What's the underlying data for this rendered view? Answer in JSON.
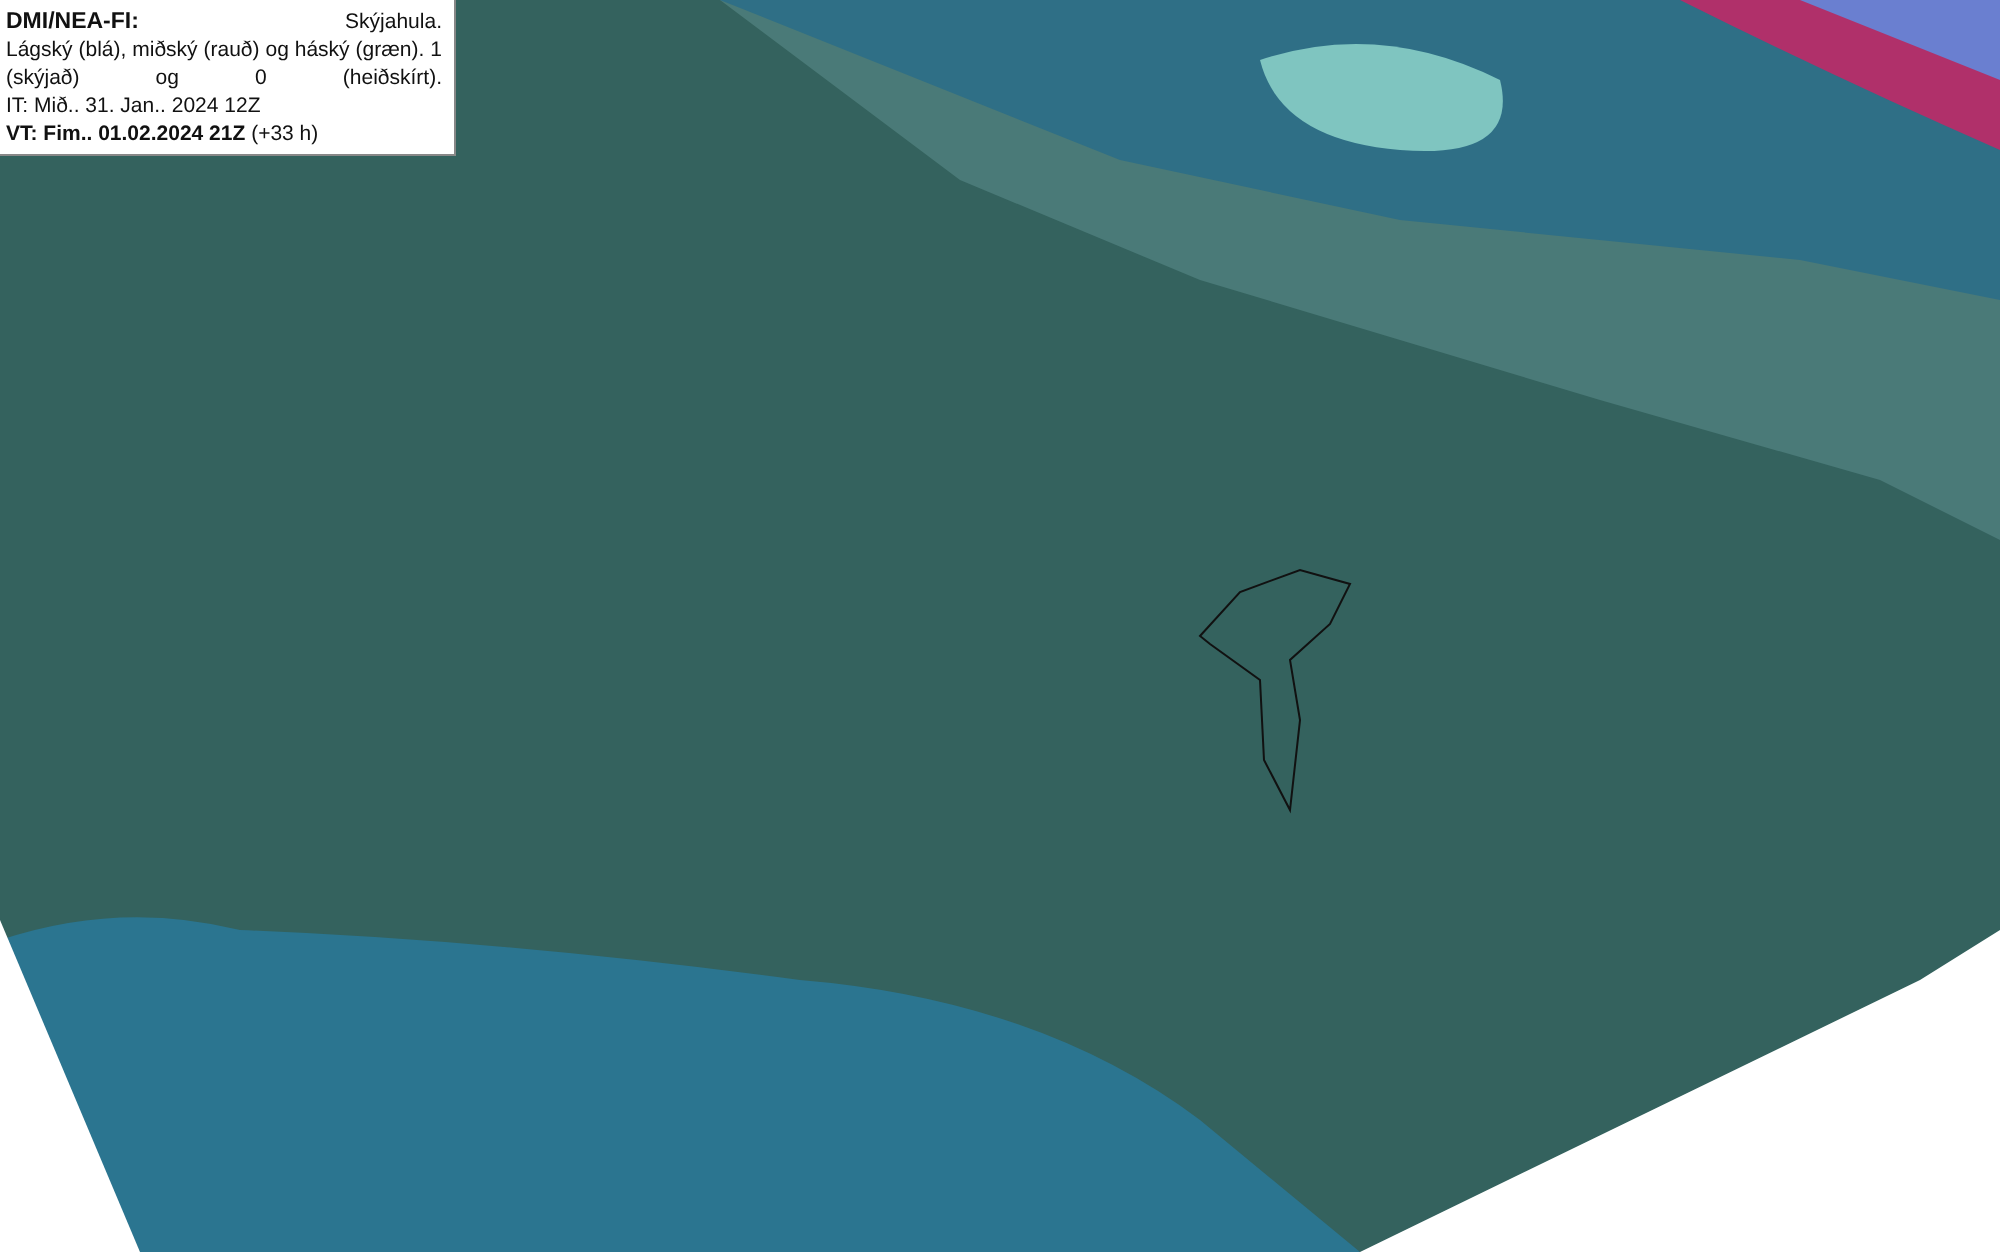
{
  "legend": {
    "source": "DMI/NEA-FI:",
    "title": "Skýjahula.",
    "description": "Lágský (blá), miðský (rauð) og háský (græn). 1 (skýjað) og 0 (heiðskírt).",
    "issued": "IT: Mið.. 31. Jan.. 2024 12Z",
    "valid": "**VT: Fim.. 01.02.2024 21Z** (+33 h)"
  }
}
